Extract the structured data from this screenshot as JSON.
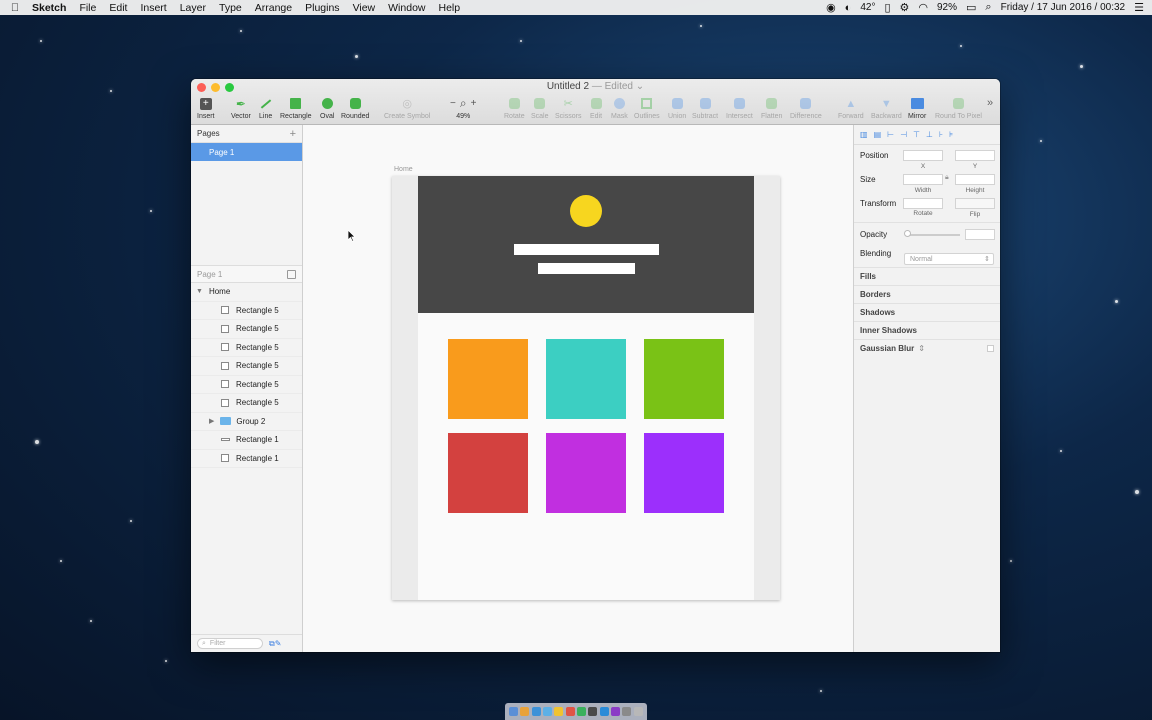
{
  "menubar": {
    "app_name": "Sketch",
    "menus": [
      "File",
      "Edit",
      "Insert",
      "Layer",
      "Type",
      "Arrange",
      "Plugins",
      "View",
      "Window",
      "Help"
    ],
    "temperature": "42°",
    "battery": "92%",
    "datetime": "Friday / 17 Jun 2016 / 00:32"
  },
  "window": {
    "title": "Untitled 2",
    "edited": "— Edited ⌄"
  },
  "toolbar": {
    "insert": "Insert",
    "vector": "Vector",
    "line": "Line",
    "rectangle": "Rectangle",
    "oval": "Oval",
    "rounded": "Rounded",
    "create_symbol": "Create Symbol",
    "zoom": "49%",
    "rotate": "Rotate",
    "scale": "Scale",
    "scissors": "Scissors",
    "edit": "Edit",
    "mask": "Mask",
    "outlines": "Outlines",
    "union": "Union",
    "subtract": "Subtract",
    "intersect": "Intersect",
    "flatten": "Flatten",
    "difference": "Difference",
    "forward": "Forward",
    "backward": "Backward",
    "mirror": "Mirror",
    "round_to_pixel": "Round To Pixel"
  },
  "pages": {
    "header": "Pages",
    "items": [
      "Page 1"
    ],
    "current_label": "Page 1"
  },
  "layers": {
    "artboard": "Home",
    "items": [
      {
        "name": "Rectangle 5",
        "kind": "rect"
      },
      {
        "name": "Rectangle 5",
        "kind": "rect"
      },
      {
        "name": "Rectangle 5",
        "kind": "rect"
      },
      {
        "name": "Rectangle 5",
        "kind": "rect"
      },
      {
        "name": "Rectangle 5",
        "kind": "rect"
      },
      {
        "name": "Rectangle 5",
        "kind": "rect"
      },
      {
        "name": "Group 2",
        "kind": "group"
      },
      {
        "name": "Rectangle 1",
        "kind": "line"
      },
      {
        "name": "Rectangle 1",
        "kind": "rect"
      }
    ],
    "filter_placeholder": "Filter"
  },
  "canvas": {
    "artboard_label": "Home",
    "hero_color": "#474747",
    "sun_color": "#f7d61f",
    "tile_colors": [
      "#f99b1c",
      "#3ccfc2",
      "#7ac216",
      "#d3413f",
      "#c12fe0",
      "#9c2ffc"
    ]
  },
  "inspector": {
    "position": "Position",
    "x": "X",
    "y": "Y",
    "size": "Size",
    "width": "Width",
    "height": "Height",
    "transform": "Transform",
    "rotate": "Rotate",
    "flip": "Flip",
    "opacity": "Opacity",
    "blending": "Blending",
    "blending_value": "Normal",
    "sections": [
      "Fills",
      "Borders",
      "Shadows",
      "Inner Shadows",
      "Gaussian Blur"
    ]
  }
}
